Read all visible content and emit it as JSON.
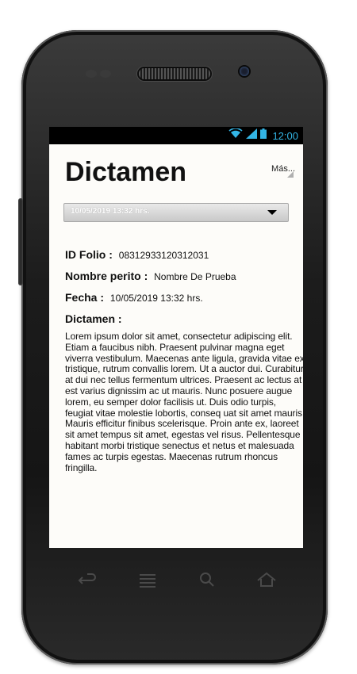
{
  "status_bar": {
    "time": "12:00",
    "icons": [
      "wifi-icon",
      "signal-icon",
      "battery-icon"
    ],
    "accent": "#33b5e5"
  },
  "app": {
    "title": "Dictamen",
    "more_label": "Más...",
    "dropdown": {
      "selected": "10/05/2019 13:32 hrs."
    },
    "fields": {
      "folio": {
        "label": "ID Folio :",
        "value": "08312933120312031"
      },
      "perito": {
        "label": "Nombre perito :",
        "value": "Nombre De Prueba"
      },
      "fecha": {
        "label": "Fecha :",
        "value": "10/05/2019 13:32 hrs."
      }
    },
    "dictamen_label": "Dictamen :",
    "dictamen_text": "Lorem ipsum dolor sit amet, consectetur adipiscing elit. Etiam a faucibus nibh. Praesent pulvinar magna eget viverra vestibulum. Maecenas ante ligula, gravida vitae ex tristique, rutrum convallis lorem. Ut a auctor dui. Curabitur at dui nec tellus fermentum ultrices. Praesent ac lectus at est varius dignissim ac ut mauris. Nunc posuere augue lorem, eu semper dolor facilisis ut. Duis odio turpis, feugiat vitae molestie lobortis, conseq uat sit amet mauris. Mauris efficitur finibus scelerisque. Proin ante ex, laoreet sit amet tempus sit amet, egestas vel risus. Pellentesque habitant morbi tristique senectus et netus et malesuada fames ac turpis egestas. Maecenas rutrum rhoncus fringilla."
  },
  "nav_buttons": [
    "back-icon",
    "menu-icon",
    "search-icon",
    "home-icon"
  ]
}
